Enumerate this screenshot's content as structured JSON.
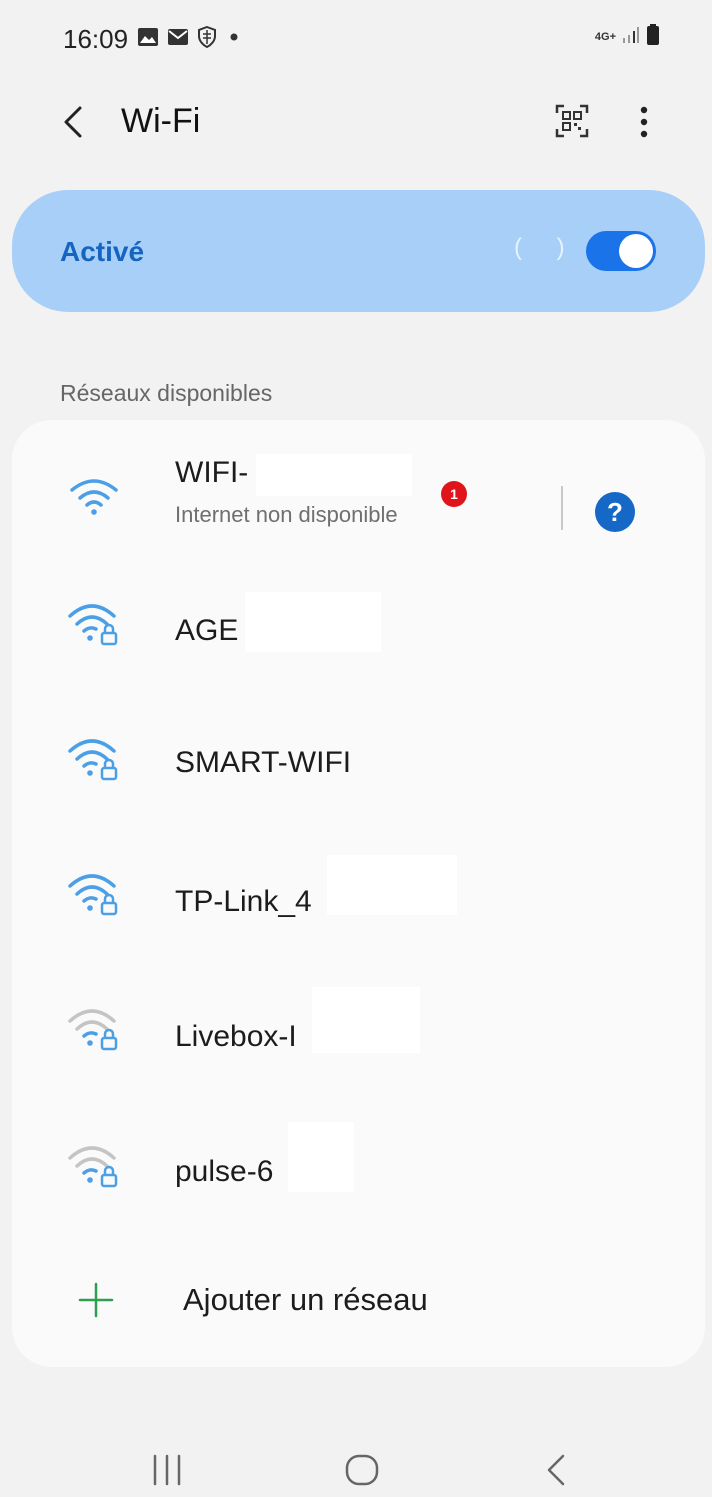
{
  "status_bar": {
    "time": "16:09",
    "left_icons": [
      "gallery-icon",
      "mail-icon",
      "shield-icon",
      "dot-icon"
    ],
    "network_type": "4G+",
    "right_icons": [
      "signal-icon",
      "battery-icon"
    ]
  },
  "header": {
    "title": "Wi-Fi",
    "back_icon": "chevron-left-icon",
    "qr_icon": "qr-code-icon",
    "more_icon": "more-vertical-icon"
  },
  "master_switch": {
    "label": "Activé",
    "enabled": true,
    "spinner": "( )"
  },
  "available_section": {
    "title": "Réseaux disponibles"
  },
  "networks": [
    {
      "name": "WIFI-",
      "subtitle": "Internet non disponible",
      "secured": false,
      "signal": "strong",
      "badge": "1",
      "has_help": true
    },
    {
      "name": "AGE",
      "secured": true,
      "signal": "strong"
    },
    {
      "name": "SMART-WIFI",
      "secured": true,
      "signal": "strong"
    },
    {
      "name": "TP-Link_4",
      "secured": true,
      "signal": "strong"
    },
    {
      "name": "Livebox-I",
      "secured": true,
      "signal": "weak"
    },
    {
      "name": "pulse-6",
      "secured": true,
      "signal": "weak"
    }
  ],
  "help_glyph": "?",
  "add_network": {
    "label": "Ajouter un réseau",
    "icon": "plus-icon"
  },
  "nav_bar": {
    "icons": [
      "recent-apps-icon",
      "home-icon",
      "back-icon"
    ]
  },
  "colors": {
    "accent": "#1a73e8",
    "master_bg": "#a8cff7",
    "wifi_strong": "#4a9fe6",
    "wifi_weak": "#bdbdbd",
    "badge": "#e0151b",
    "add_icon": "#2e9e4f"
  }
}
